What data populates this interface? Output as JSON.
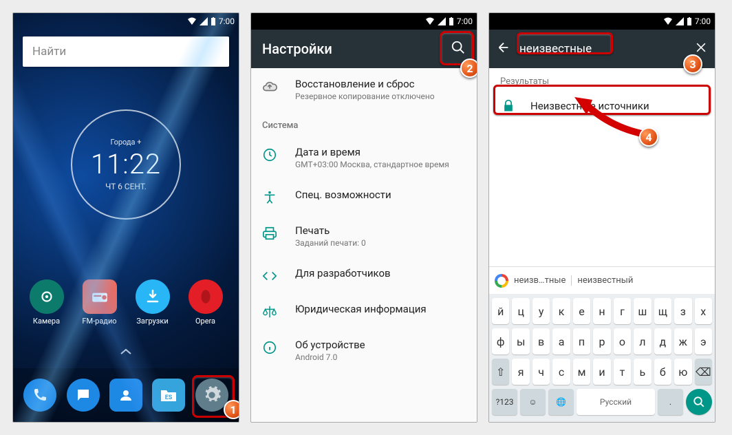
{
  "status": {
    "time": "7:00"
  },
  "home": {
    "search_placeholder": "Найти",
    "clock": {
      "city": "Города +",
      "time": "11:22",
      "date": "ЧТ 6 СЕНТ."
    },
    "apps": [
      {
        "id": "camera",
        "label": "Камера"
      },
      {
        "id": "fmradio",
        "label": "FM-радио"
      },
      {
        "id": "downloads",
        "label": "Загрузки"
      },
      {
        "id": "opera",
        "label": "Opera"
      }
    ],
    "dock": [
      {
        "id": "phone"
      },
      {
        "id": "messages"
      },
      {
        "id": "contacts"
      },
      {
        "id": "files"
      },
      {
        "id": "settings"
      }
    ]
  },
  "settings": {
    "title": "Настройки",
    "items": [
      {
        "icon": "backup",
        "title": "Восстановление и сброс",
        "sub": "Резервное копирование отключено"
      }
    ],
    "section": "Система",
    "system_items": [
      {
        "icon": "clock",
        "title": "Дата и время",
        "sub": "GMT+03:00 Москва, стандартное время"
      },
      {
        "icon": "access",
        "title": "Спец. возможности",
        "sub": ""
      },
      {
        "icon": "print",
        "title": "Печать",
        "sub": "Заданий печати: 0"
      },
      {
        "icon": "dev",
        "title": "Для разработчиков",
        "sub": ""
      },
      {
        "icon": "legal",
        "title": "Юридическая информация",
        "sub": ""
      },
      {
        "icon": "about",
        "title": "Об устройстве",
        "sub": "Android 7.0"
      }
    ]
  },
  "search": {
    "query": "неизвестные",
    "results_label": "Результаты",
    "result": "Неизвестные источники",
    "suggestions": [
      "неизв…тные",
      "неизвестный"
    ],
    "space_label": "Русский",
    "sym_label": "?123"
  },
  "keyboard": {
    "row1": [
      "й",
      "ц",
      "у",
      "к",
      "е",
      "н",
      "г",
      "ш",
      "щ",
      "з",
      "х"
    ],
    "row2": [
      "ф",
      "ы",
      "в",
      "а",
      "п",
      "р",
      "о",
      "л",
      "д",
      "ж",
      "э"
    ],
    "row3": [
      "⇧",
      "я",
      "ч",
      "с",
      "м",
      "и",
      "т",
      "ь",
      "б",
      "ю",
      "⌫"
    ]
  },
  "steps": {
    "1": "1",
    "2": "2",
    "3": "3",
    "4": "4"
  }
}
